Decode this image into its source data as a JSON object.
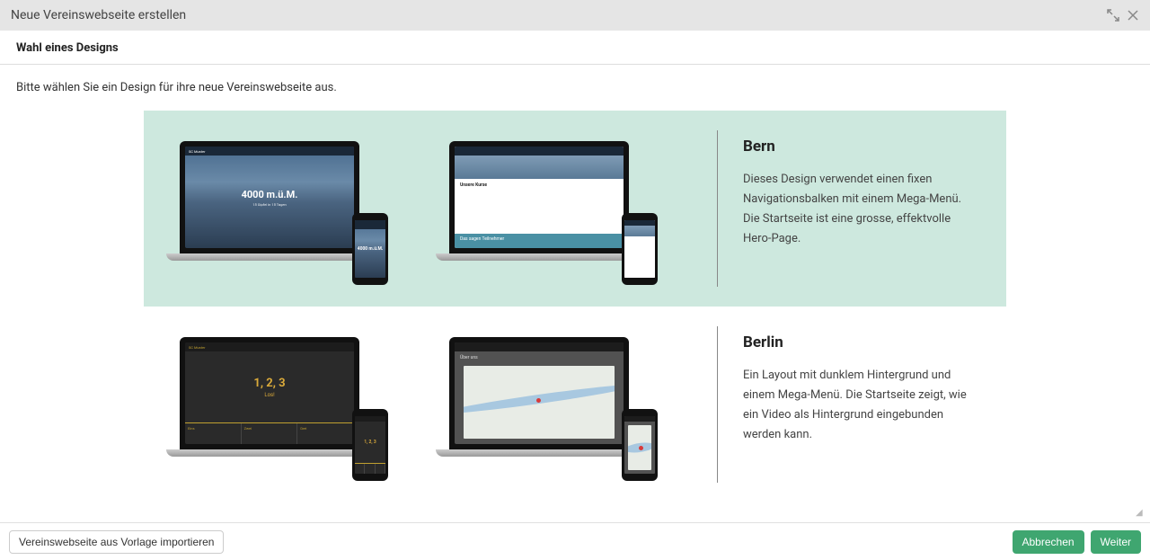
{
  "modal": {
    "title": "Neue Vereinswebseite erstellen"
  },
  "step": {
    "title": "Wahl eines Designs",
    "instruction": "Bitte wählen Sie ein Design für ihre neue Vereinswebseite aus."
  },
  "designs": [
    {
      "id": "bern",
      "name": "Bern",
      "description": "Dieses Design verwendet einen fixen Navigationsbalken mit einem Mega-Menü. Die Startseite ist eine grosse, effektvolle Hero-Page.",
      "selected": true,
      "preview": {
        "brand": "SC Muster",
        "hero_text": "4000 m.ü.M.",
        "hero_sub": "15 Gipfel in 15 Tagen",
        "section1": "Unsere Kurse",
        "section2": "Das sagen Teilnehmer"
      }
    },
    {
      "id": "berlin",
      "name": "Berlin",
      "description": "Ein Layout mit dunklem Hintergrund und einem Mega-Menü. Die Startseite zeigt, wie ein Video als Hintergrund eingebunden werden kann.",
      "selected": false,
      "preview": {
        "brand": "SC Muster",
        "hero_text": "1, 2, 3",
        "hero_sub": "Los!",
        "col1": "Eins",
        "col2": "Zwei",
        "col3": "Drei",
        "page2_title": "Über uns"
      }
    }
  ],
  "footer": {
    "import_label": "Vereinswebseite aus Vorlage importieren",
    "cancel_label": "Abbrechen",
    "next_label": "Weiter"
  },
  "colors": {
    "selected_bg": "#cde8de",
    "primary": "#3fa670"
  }
}
